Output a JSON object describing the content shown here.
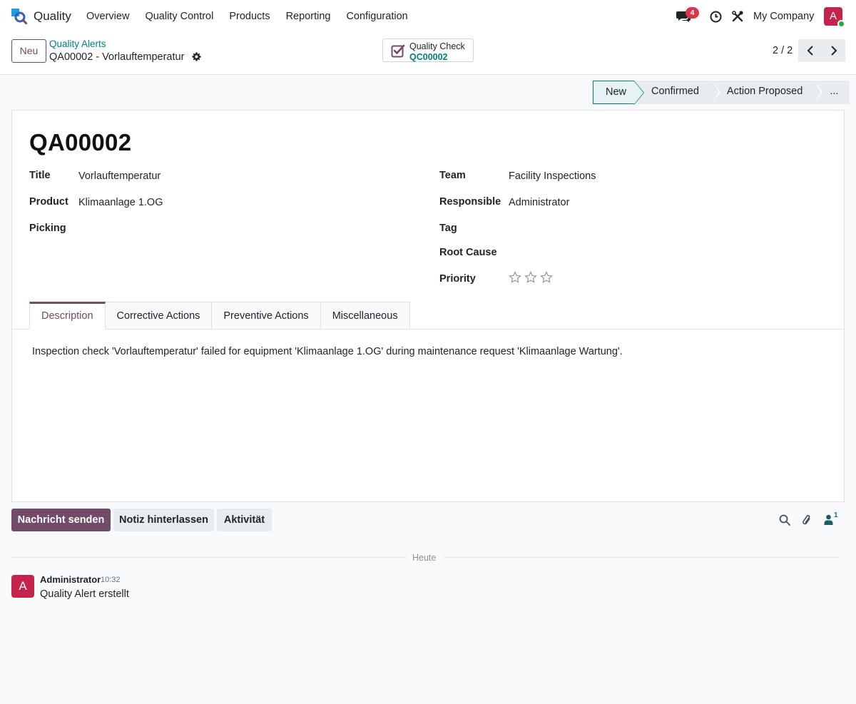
{
  "navbar": {
    "app_name": "Quality",
    "menu": [
      "Overview",
      "Quality Control",
      "Products",
      "Reporting",
      "Configuration"
    ],
    "chat_badge": "4",
    "company": "My Company",
    "avatar_letter": "A"
  },
  "control": {
    "new_button": "Neu",
    "breadcrumb_parent": "Quality Alerts",
    "breadcrumb_current": "QA00002 - Vorlauftemperatur",
    "smart_button": {
      "label": "Quality Check",
      "value": "QC00002"
    },
    "pager": "2 / 2"
  },
  "statusbar": {
    "stages": [
      "New",
      "Confirmed",
      "Action Proposed",
      "..."
    ],
    "active_stage": "New"
  },
  "record": {
    "name": "QA00002",
    "fields_left": [
      {
        "label": "Title",
        "value": "Vorlauftemperatur"
      },
      {
        "label": "Product",
        "value": "Klimaanlage 1.OG"
      },
      {
        "label": "Picking",
        "value": ""
      }
    ],
    "fields_right": [
      {
        "label": "Team",
        "value": "Facility Inspections"
      },
      {
        "label": "Responsible",
        "value": "Administrator"
      },
      {
        "label": "Tag",
        "value": ""
      },
      {
        "label": "Root Cause",
        "value": ""
      },
      {
        "label": "Priority",
        "value": ""
      }
    ],
    "priority_stars": 0
  },
  "tabs": {
    "items": [
      "Description",
      "Corrective Actions",
      "Preventive Actions",
      "Miscellaneous"
    ],
    "active": "Description"
  },
  "description": "Inspection check 'Vorlauftemperatur' failed for equipment 'Klimaanlage 1.OG' during maintenance request 'Klimaanlage Wartung'.",
  "chatter": {
    "send_message": "Nachricht senden",
    "log_note": "Notiz hinterlassen",
    "activity": "Aktivität",
    "follower_count": "1",
    "day_separator": "Heute",
    "messages": [
      {
        "avatar_letter": "A",
        "author": "Administrator",
        "time": "10:32",
        "body": "Quality Alert erstellt"
      }
    ]
  },
  "colors": {
    "brand": "#714b67",
    "accent": "#017e84",
    "badge": "#d9364b",
    "avatar": "#c4244b"
  }
}
